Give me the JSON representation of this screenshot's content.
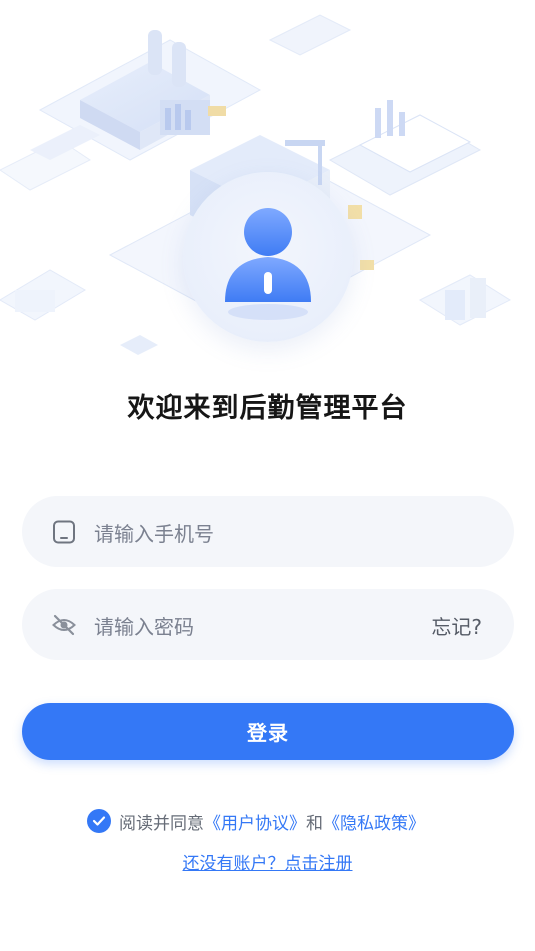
{
  "title": "欢迎来到后勤管理平台",
  "phone_field": {
    "placeholder": "请输入手机号",
    "icon": "phone-icon"
  },
  "password_field": {
    "placeholder": "请输入密码",
    "icon": "eye-off-icon",
    "forgot_label": "忘记?"
  },
  "login_button": {
    "label": "登录"
  },
  "agreement": {
    "checked": true,
    "prefix": "阅读并同意",
    "user_agreement": "《用户协议》",
    "conjunction": "和",
    "privacy_policy": "《隐私政策》"
  },
  "register_link": "还没有账户？点击注册",
  "colors": {
    "primary": "#3478f6",
    "field_bg": "#f4f6fa",
    "title": "#161616"
  }
}
